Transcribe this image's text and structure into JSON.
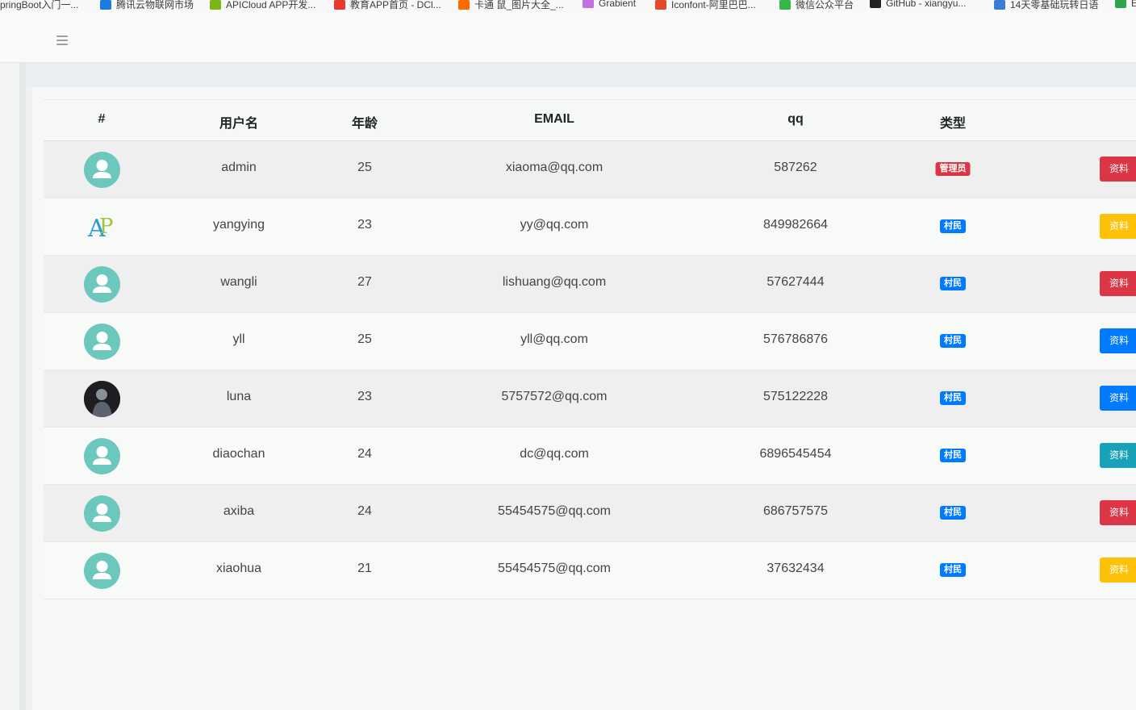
{
  "bookmarks": [
    {
      "label": "pringBoot入门一...",
      "icon": "page-icon",
      "color": "#ffffff"
    },
    {
      "label": "腾讯云物联网市场",
      "icon": "tencent-cloud-icon",
      "color": "#1f7adf"
    },
    {
      "label": "APICloud APP开发...",
      "icon": "apicloud-icon",
      "color": "#7cb518"
    },
    {
      "label": "教育APP首页 - DCl...",
      "icon": "dcloud-icon",
      "color": "#e8392d"
    },
    {
      "label": "卡通 鼠_图片大全_...",
      "icon": "photo-site-icon",
      "color": "#ff6a00"
    },
    {
      "label": "Grabient",
      "icon": "grabient-icon",
      "color": "#c26fe0"
    },
    {
      "label": "Iconfont-阿里巴巴...",
      "icon": "iconfont-icon",
      "color": "#e24a2b"
    },
    {
      "label": "微信公众平台",
      "icon": "wechat-icon",
      "color": "#37b44a"
    },
    {
      "label": "GitHub - xiangyu...",
      "icon": "github-icon",
      "color": "#222222"
    },
    {
      "label": "14天零基础玩转日语",
      "icon": "doc-icon",
      "color": "#3a7bd5"
    },
    {
      "label": "E",
      "icon": "e-icon",
      "color": "#2ea44f"
    }
  ],
  "header": {
    "menu_icon": "hamburger-icon"
  },
  "table": {
    "headers": [
      "#",
      "用户名",
      "年龄",
      "EMAIL",
      "qq",
      "类型"
    ],
    "rows": [
      {
        "avatar": "default-avatar",
        "username": "admin",
        "age": "25",
        "email": "xiaoma@qq.com",
        "qq": "587262",
        "type": "管理员",
        "type_color": "#dc3545",
        "action": "资料",
        "action_color": "#dc3545"
      },
      {
        "avatar": "ap-logo-avatar",
        "username": "yangying",
        "age": "23",
        "email": "yy@qq.com",
        "qq": "849982664",
        "type": "村民",
        "type_color": "#007bff",
        "action": "资料",
        "action_color": "#ffc107"
      },
      {
        "avatar": "default-avatar",
        "username": "wangli",
        "age": "27",
        "email": "lishuang@qq.com",
        "qq": "57627444",
        "type": "村民",
        "type_color": "#007bff",
        "action": "资料",
        "action_color": "#dc3545"
      },
      {
        "avatar": "default-avatar",
        "username": "yll",
        "age": "25",
        "email": "yll@qq.com",
        "qq": "576786876",
        "type": "村民",
        "type_color": "#007bff",
        "action": "资料",
        "action_color": "#007bff"
      },
      {
        "avatar": "photo-avatar",
        "username": "luna",
        "age": "23",
        "email": "5757572@qq.com",
        "qq": "575122228",
        "type": "村民",
        "type_color": "#007bff",
        "action": "资料",
        "action_color": "#007bff"
      },
      {
        "avatar": "default-avatar",
        "username": "diaochan",
        "age": "24",
        "email": "dc@qq.com",
        "qq": "6896545454",
        "type": "村民",
        "type_color": "#007bff",
        "action": "资料",
        "action_color": "#17a2b8"
      },
      {
        "avatar": "default-avatar",
        "username": "axiba",
        "age": "24",
        "email": "55454575@qq.com",
        "qq": "686757575",
        "type": "村民",
        "type_color": "#007bff",
        "action": "资料",
        "action_color": "#dc3545"
      },
      {
        "avatar": "default-avatar",
        "username": "xiaohua",
        "age": "21",
        "email": "55454575@qq.com",
        "qq": "37632434",
        "type": "村民",
        "type_color": "#007bff",
        "action": "资料",
        "action_color": "#ffc107"
      }
    ]
  }
}
